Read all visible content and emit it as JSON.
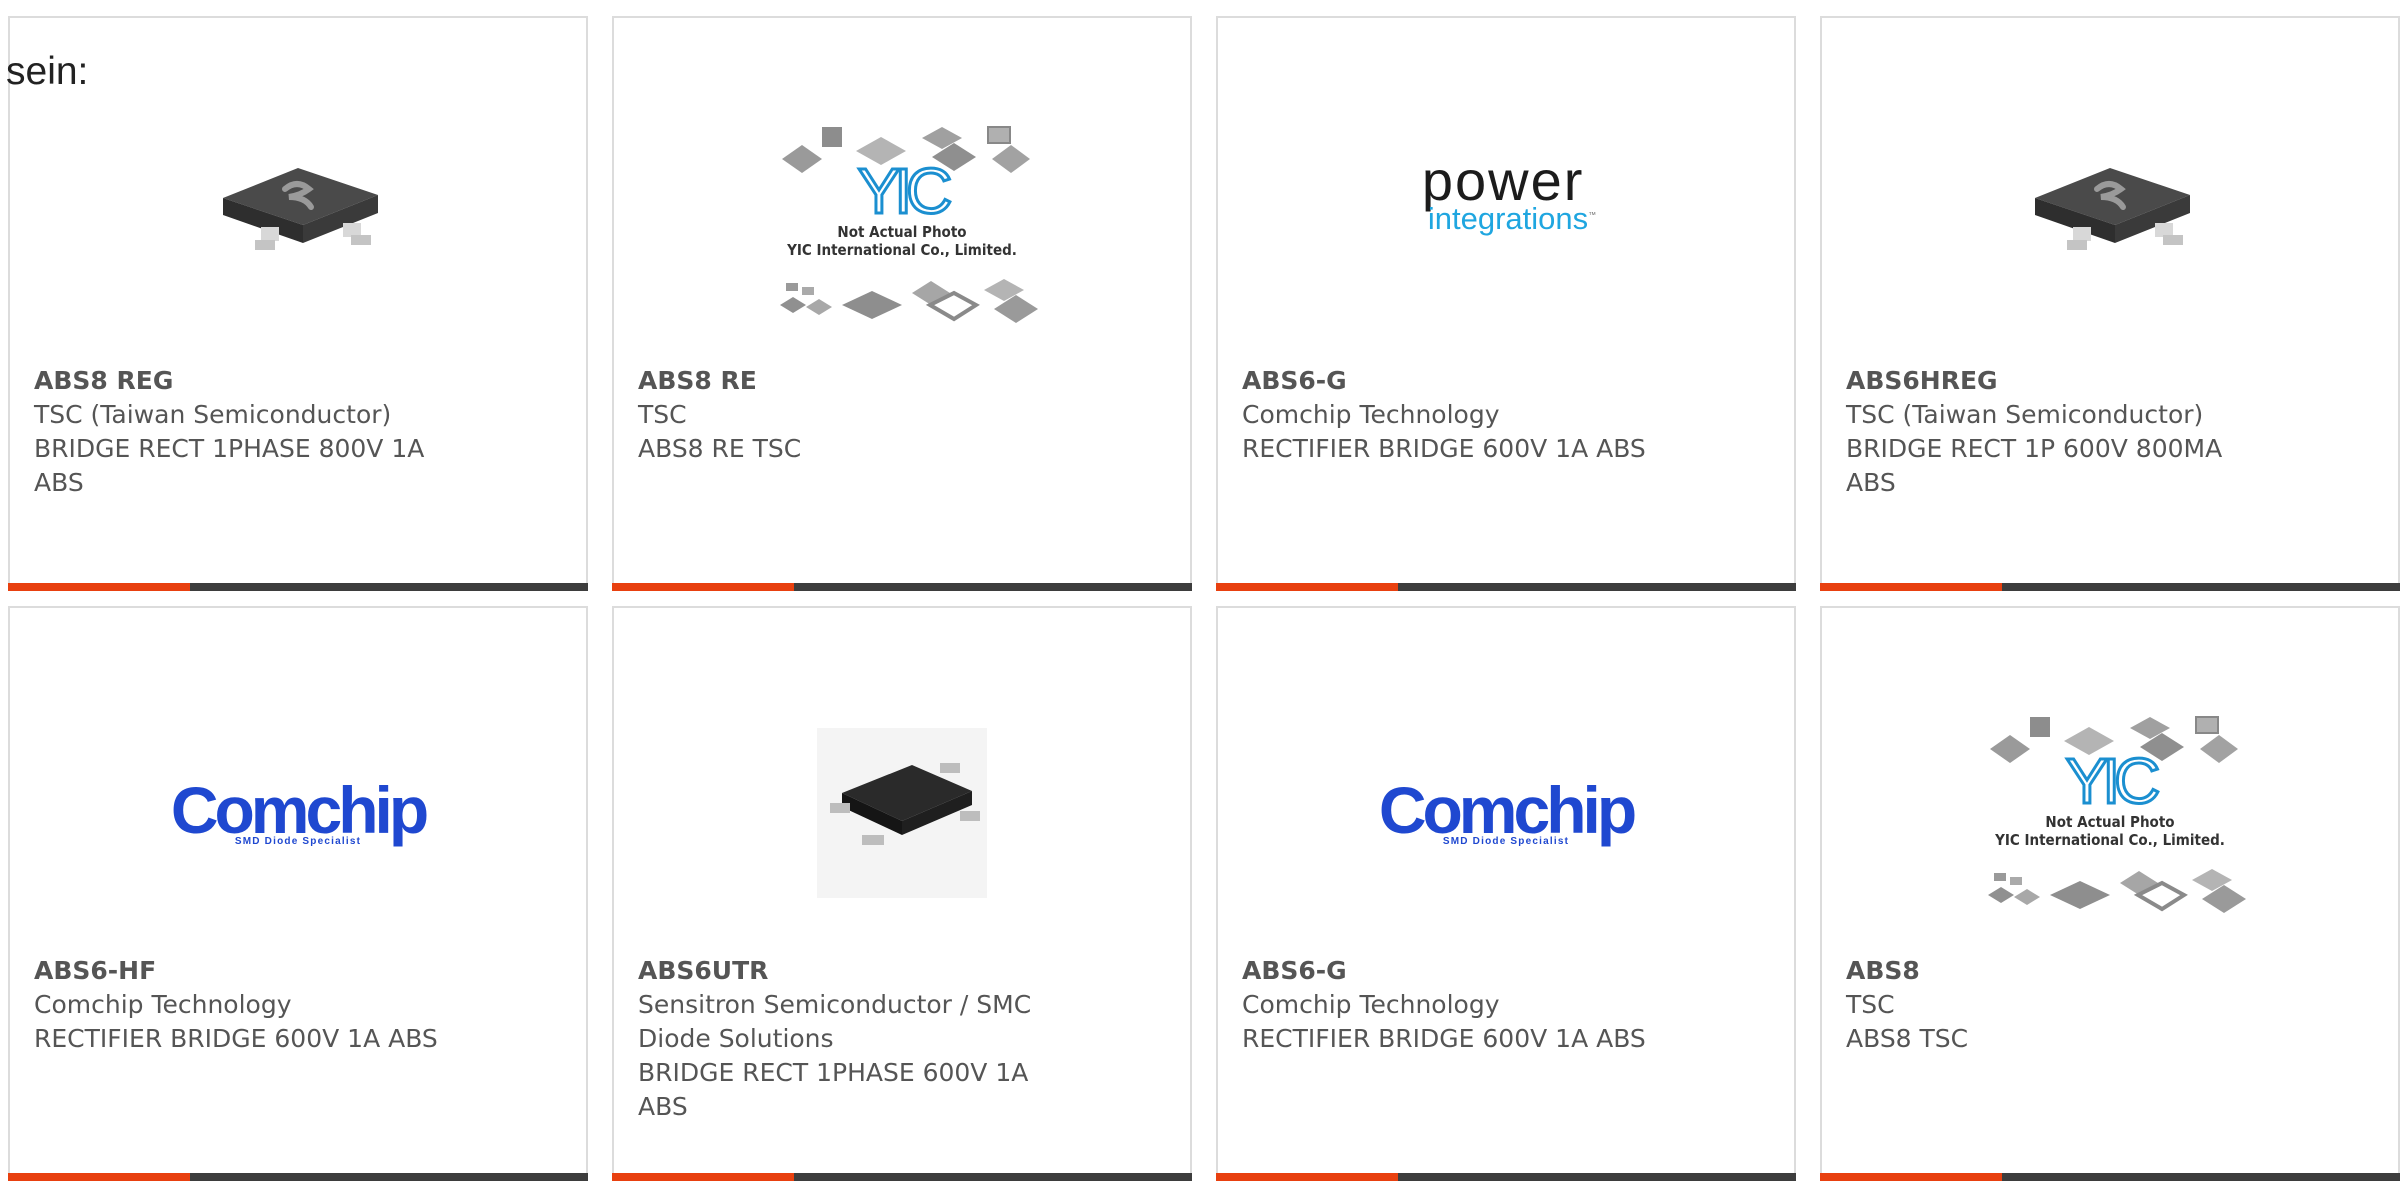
{
  "intro": {
    "text": "sein:"
  },
  "products": [
    {
      "part": "ABS8 REG",
      "manufacturer": "TSC (Taiwan Semiconductor)",
      "description": "BRIDGE RECT 1PHASE 800V 1A ABS",
      "image": "bridge-rectifier-photo"
    },
    {
      "part": "ABS8 RE",
      "manufacturer": "TSC",
      "description": "ABS8 RE TSC",
      "image": "yic-not-actual-photo"
    },
    {
      "part": "ABS6-G",
      "manufacturer": "Comchip Technology",
      "description": "RECTIFIER BRIDGE 600V 1A ABS",
      "image": "power-integrations-logo"
    },
    {
      "part": "ABS6HREG",
      "manufacturer": "TSC (Taiwan Semiconductor)",
      "description": "BRIDGE RECT 1P 600V 800MA ABS",
      "image": "bridge-rectifier-photo"
    },
    {
      "part": "ABS6-HF",
      "manufacturer": "Comchip Technology",
      "description": "RECTIFIER BRIDGE 600V 1A ABS",
      "image": "comchip-logo"
    },
    {
      "part": "ABS6UTR",
      "manufacturer": "Sensitron Semiconductor / SMC Diode Solutions",
      "description": "BRIDGE RECT 1PHASE 600V 1A ABS",
      "image": "black-ic-photo"
    },
    {
      "part": "ABS6-G",
      "manufacturer": "Comchip Technology",
      "description": "RECTIFIER BRIDGE 600V 1A ABS",
      "image": "comchip-logo"
    },
    {
      "part": "ABS8",
      "manufacturer": "TSC",
      "description": "ABS8 TSC",
      "image": "yic-not-actual-photo"
    }
  ],
  "logos": {
    "comchip_word": "Comchip",
    "comchip_tagline": "SMD Diode Specialist",
    "power_word": "power",
    "power_sub": "integrations",
    "yic_line1": "Not Actual Photo",
    "yic_line2": "YIC International Co., Limited.",
    "yic_mark": "YIC",
    "tsc_mark": "S"
  },
  "colors": {
    "accent": "#e8400f",
    "bar": "#3d3d3d",
    "border": "#dcdcdc",
    "text": "#555555",
    "comchip_blue": "#1f48d0",
    "power_blue": "#1fa6e0"
  }
}
